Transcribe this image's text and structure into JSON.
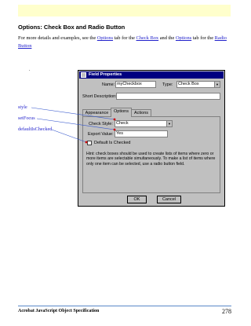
{
  "section_title": "Options: Check Box and Radio Button",
  "intro": {
    "text_1": "For more details and examples, see the ",
    "link_options_1": "Options",
    "text_2": " tab for the ",
    "link_check_box": "Check Box",
    "text_3": " and the ",
    "link_options_2": "Options",
    "text_4": " tab for the ",
    "link_radio_button": "Radio Button"
  },
  "dot": ".",
  "callouts": [
    "style",
    "setFocus",
    "defaultIsChecked"
  ],
  "dialog": {
    "title": "Field Properties",
    "name_label": "Name:",
    "name_value": "myCheckbox",
    "type_label": "Type:",
    "type_value": "Check Box",
    "short_desc_label": "Short Description:",
    "tabs": [
      "Appearance",
      "Options",
      "Actions"
    ],
    "check_style_label": "Check Style:",
    "check_style_value": "Check",
    "export_value_label": "Export Value:",
    "export_value_value": "Yes",
    "default_checked_label": "Default Is Checked",
    "hint": "Hint: check boxes should be used to create lists of items where zero or more items are selectable simultaneously. To make a list of items where only one item can be selected, use a radio button field.",
    "ok": "OK",
    "cancel": "Cancel"
  },
  "footer": {
    "title": "Acrobat JavaScript Object Specification",
    "page": "278"
  },
  "colors": {
    "band": "#ffffcc",
    "link": "#2222cc",
    "titlebar": "#000080",
    "dialog_bg": "#c0c0c0",
    "arrow": "#cc0000",
    "footer_rule": "#5a88c8"
  }
}
